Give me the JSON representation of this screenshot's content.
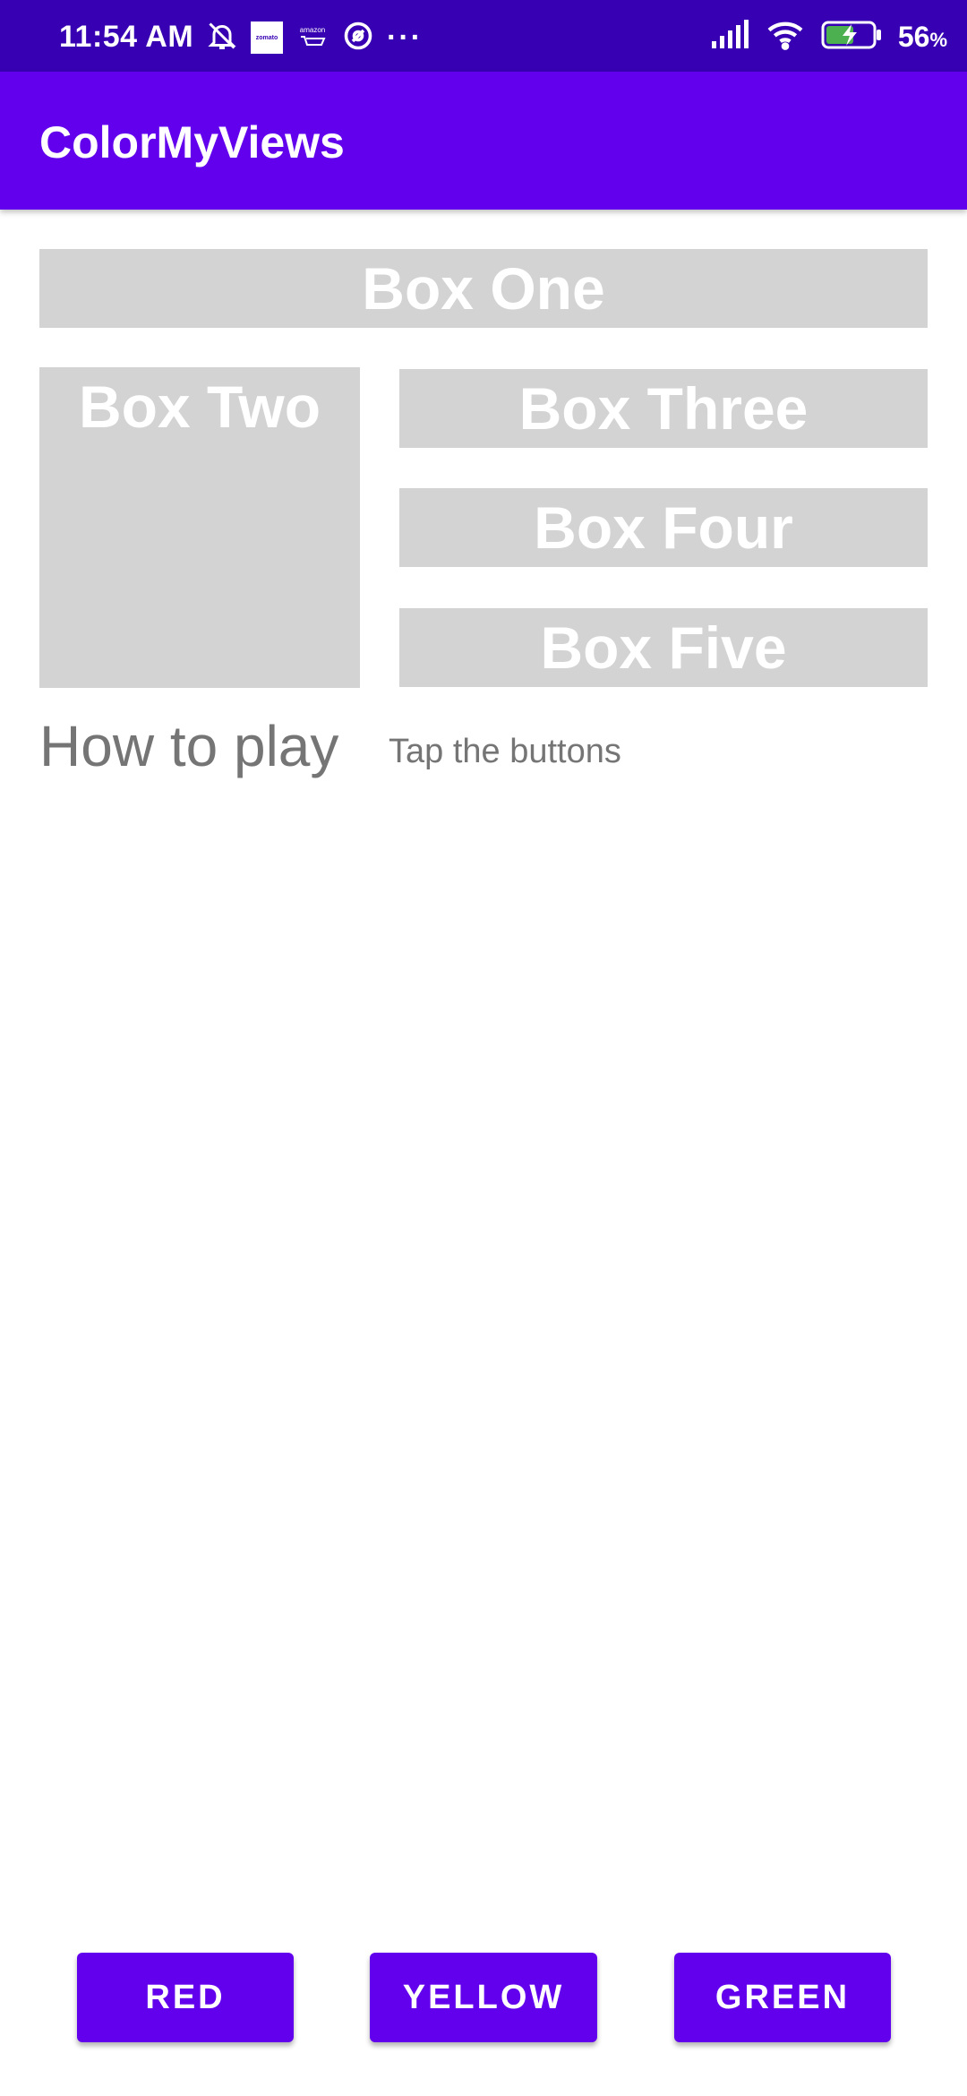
{
  "status_bar": {
    "time": "11:54 AM",
    "battery_percent": "56",
    "battery_unit": "%",
    "app_icon_zomato": "zomato",
    "app_icon_amazon": "amazon",
    "more_dots": "···",
    "icons_left": [
      "bell-off-icon",
      "zomato-icon",
      "amazon-icon",
      "target-icon",
      "more-dots-icon"
    ],
    "icons_right": [
      "signal-icon",
      "wifi-icon",
      "battery-charging-icon"
    ]
  },
  "app_bar": {
    "title": "ColorMyViews"
  },
  "boxes": {
    "one": "Box One",
    "two": "Box Two",
    "three": "Box Three",
    "four": "Box Four",
    "five": "Box Five"
  },
  "info": {
    "label": "How to play",
    "text": "Tap the buttons"
  },
  "buttons": {
    "red": "RED",
    "yellow": "YELLOW",
    "green": "GREEN"
  },
  "colors": {
    "status_bar": "#3700B3",
    "app_bar": "#6200EE",
    "box": "#D3D3D3",
    "button": "#6200EE",
    "info_text": "#757575"
  }
}
